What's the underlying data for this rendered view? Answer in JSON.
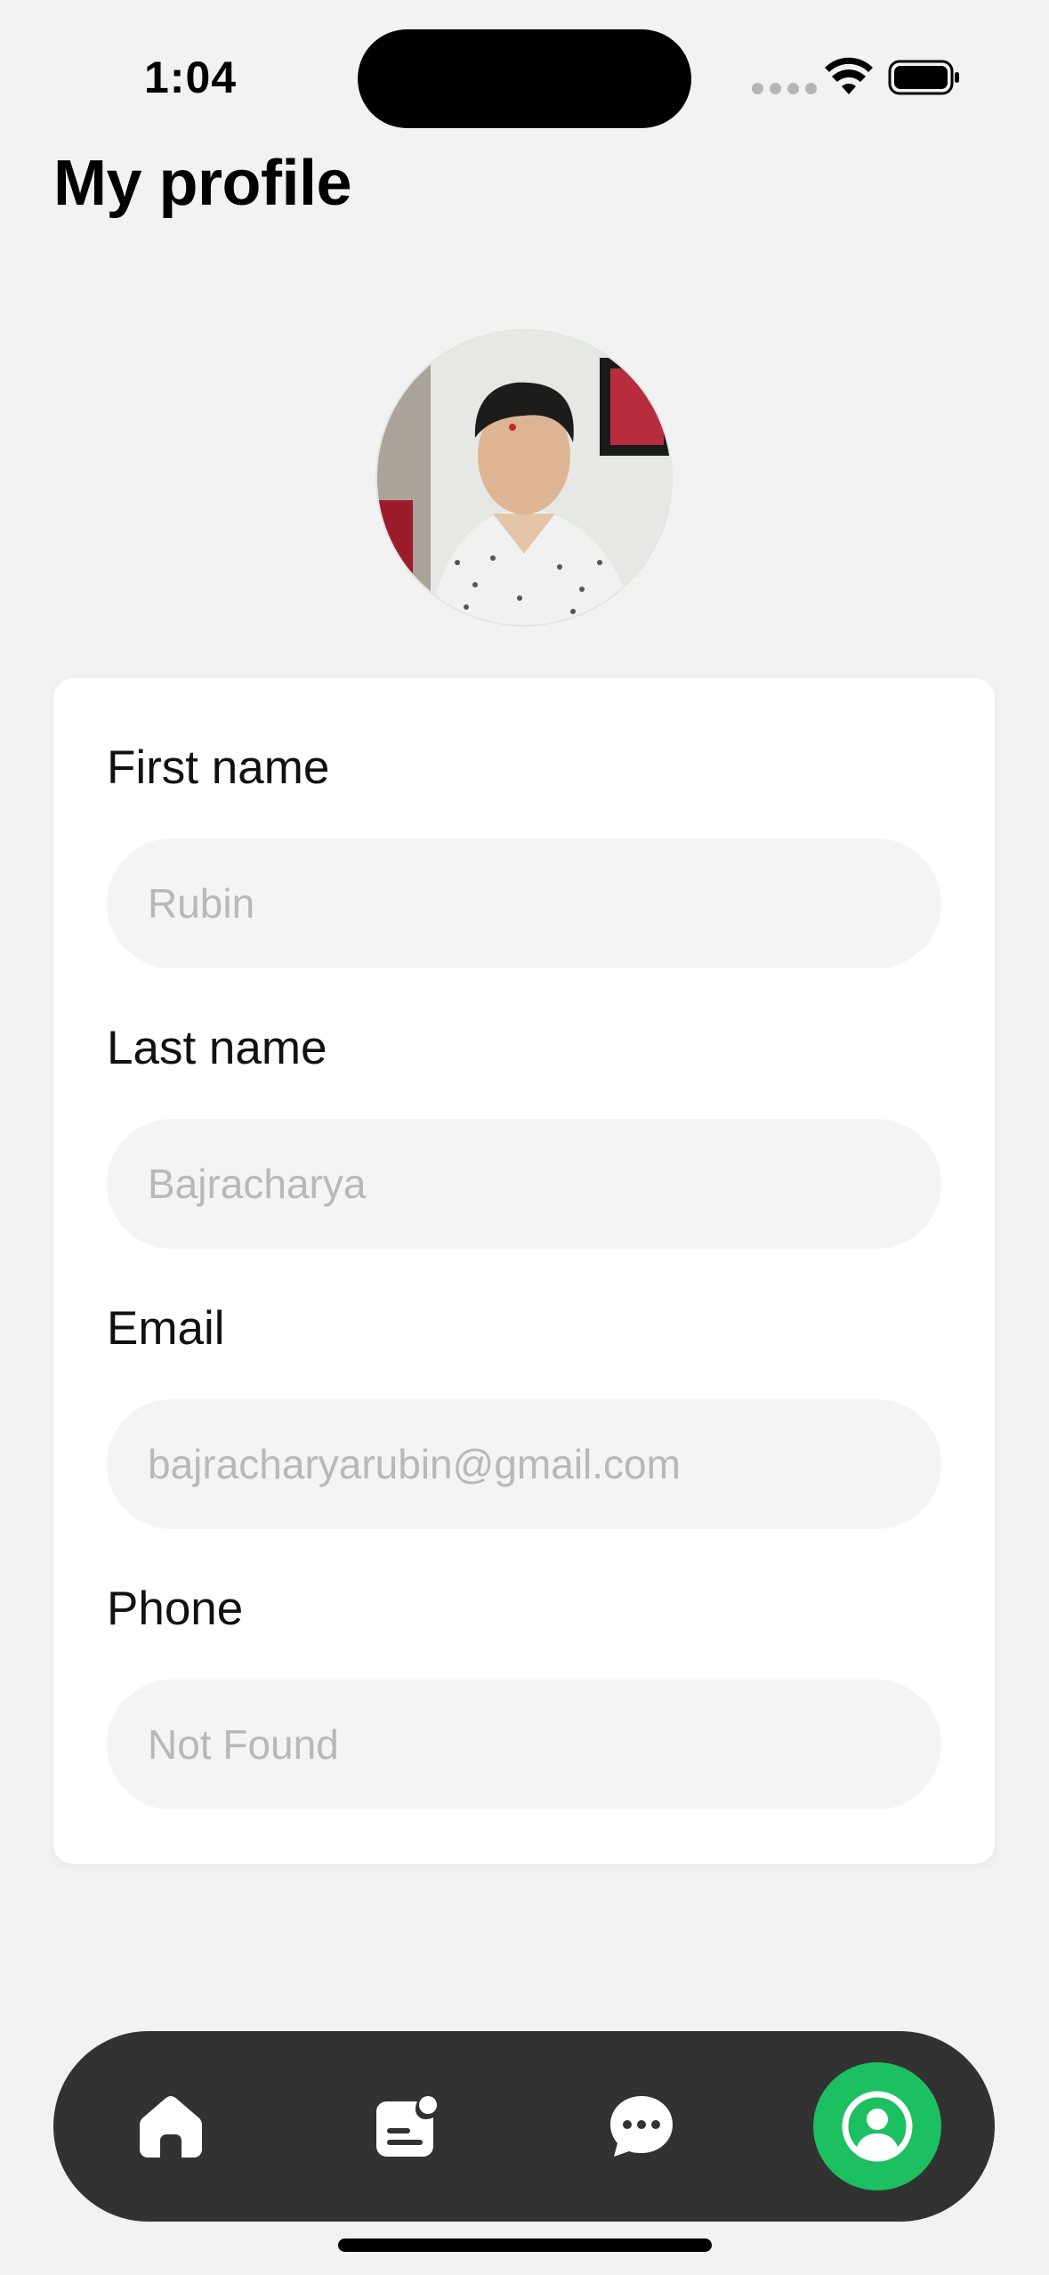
{
  "status_bar": {
    "time": "1:04",
    "icons": [
      "signal-dots-icon",
      "wifi-icon",
      "battery-icon"
    ]
  },
  "header": {
    "title": "My profile"
  },
  "avatar": {
    "alt": "profile photo"
  },
  "form": {
    "first_name": {
      "label": "First name",
      "value": "Rubin"
    },
    "last_name": {
      "label": "Last name",
      "value": "Bajracharya"
    },
    "email": {
      "label": "Email",
      "value": "bajracharyarubin@gmail.com"
    },
    "phone": {
      "label": "Phone",
      "value": "Not Found"
    }
  },
  "tab_bar": {
    "tabs": [
      {
        "icon": "home-icon",
        "active": false
      },
      {
        "icon": "news-icon",
        "active": false
      },
      {
        "icon": "chat-icon",
        "active": false
      },
      {
        "icon": "profile-icon",
        "active": true
      }
    ],
    "active_color": "#1cc060",
    "bar_color": "#323232"
  }
}
